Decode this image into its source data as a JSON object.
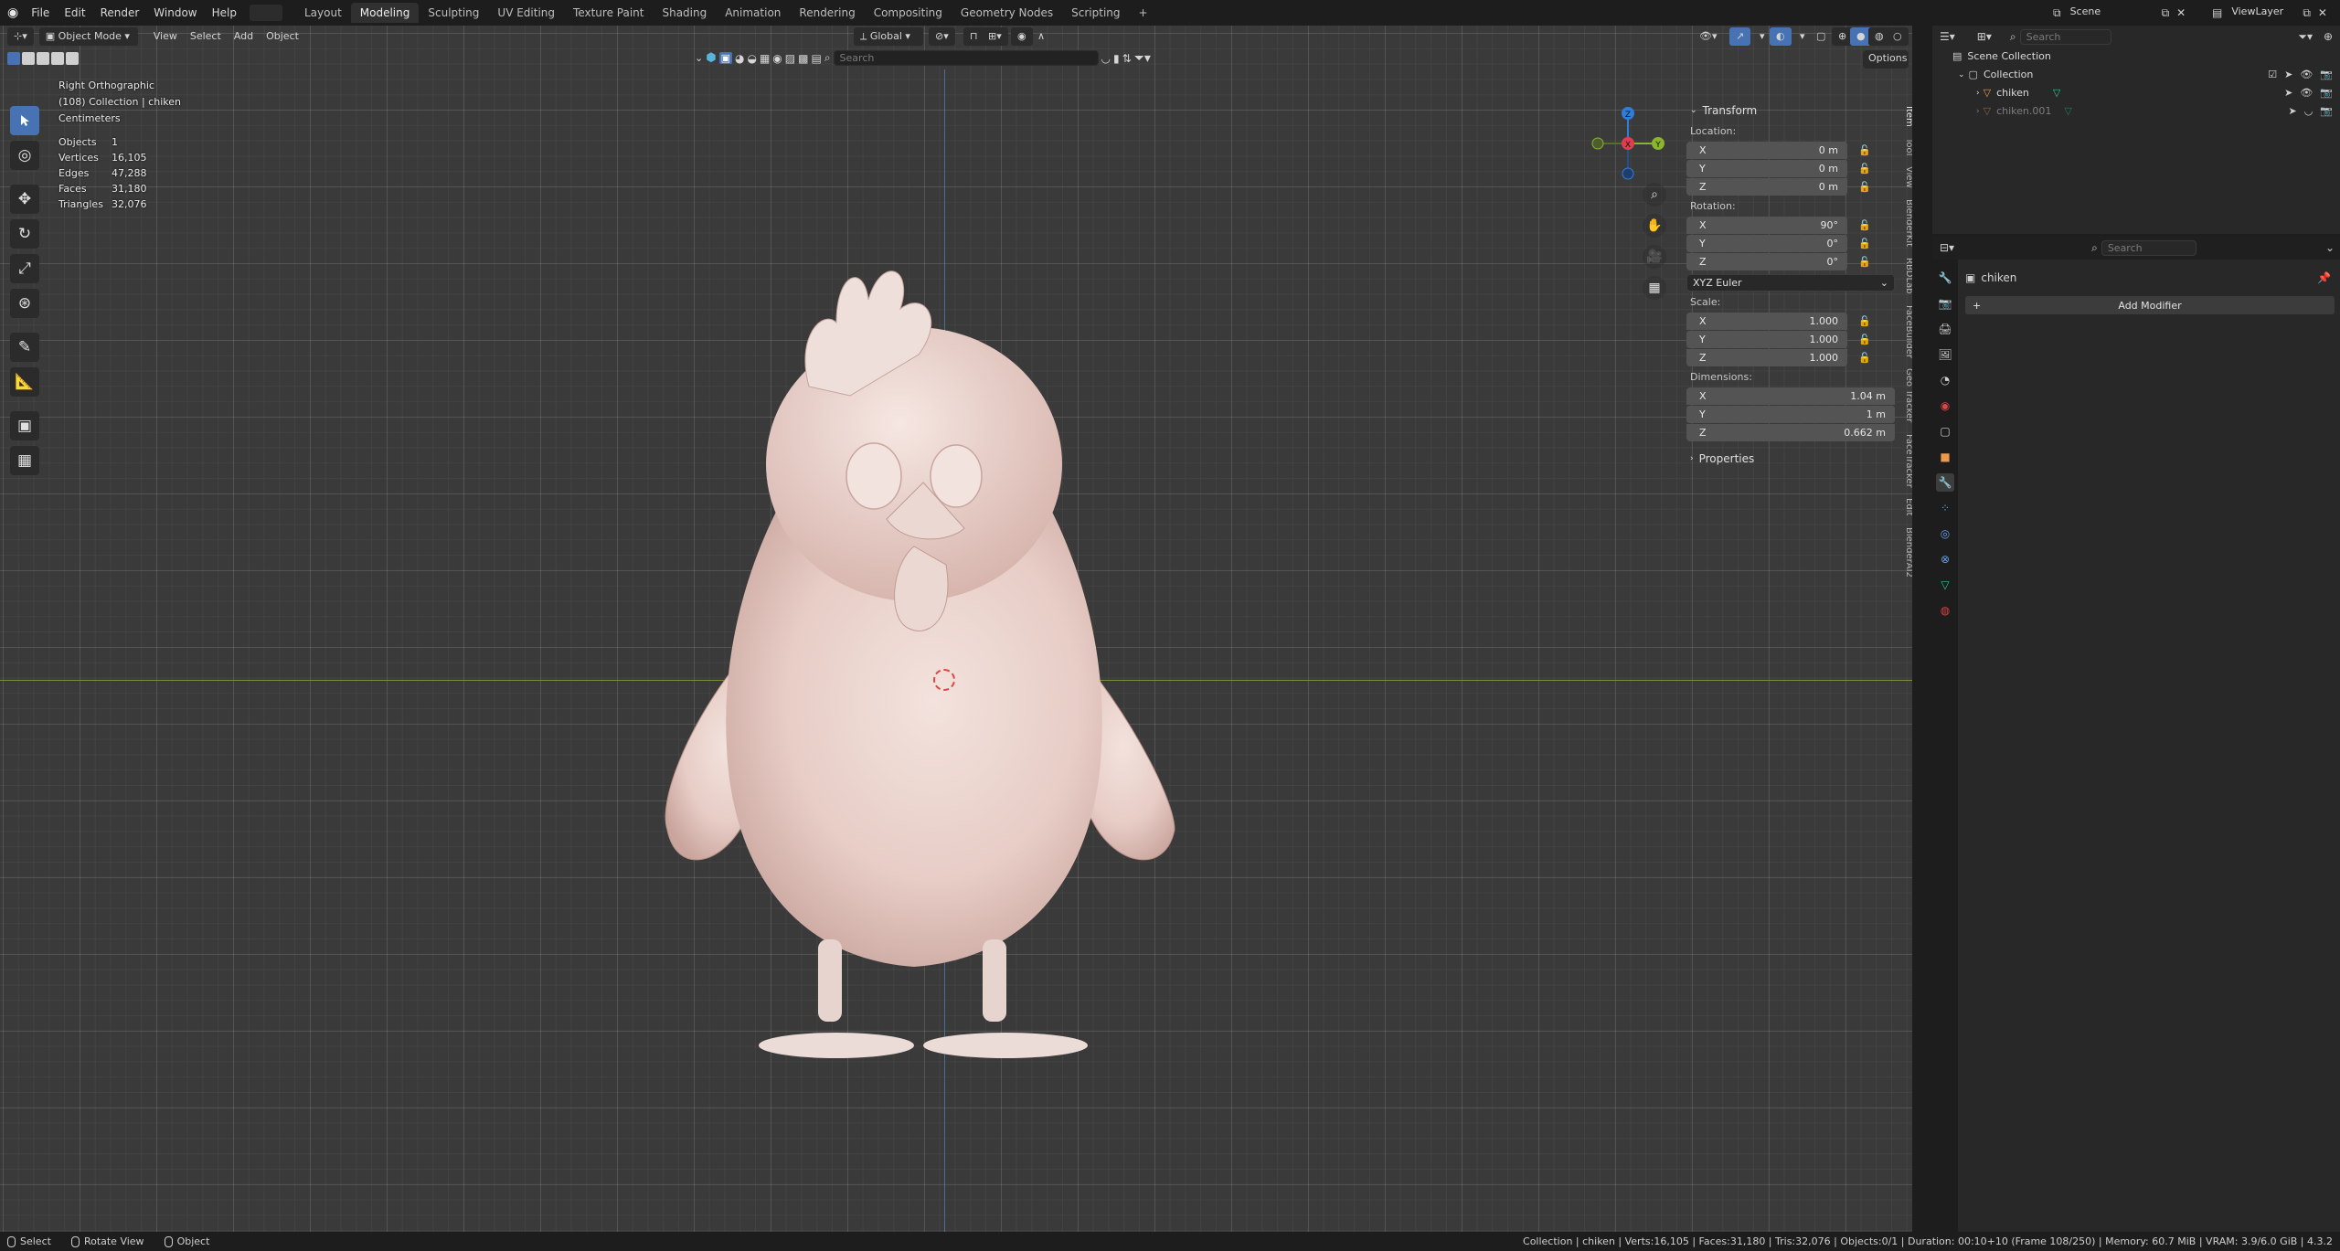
{
  "menu": [
    "File",
    "Edit",
    "Render",
    "Window",
    "Help"
  ],
  "workspaces": [
    "Layout",
    "Modeling",
    "Sculpting",
    "UV Editing",
    "Texture Paint",
    "Shading",
    "Animation",
    "Rendering",
    "Compositing",
    "Geometry Nodes",
    "Scripting",
    "+"
  ],
  "active_workspace": "Modeling",
  "scene": {
    "name": "Scene",
    "view_layer": "ViewLayer"
  },
  "viewport_header": {
    "mode": "Object Mode",
    "menus": [
      "View",
      "Select",
      "Add",
      "Object"
    ],
    "orientation": "Global",
    "options": "Options",
    "search_placeholder": "Search"
  },
  "overlay": {
    "view_name": "Right Orthographic",
    "collection_line": "(108) Collection | chiken",
    "units": "Centimeters",
    "stats": [
      {
        "label": "Objects",
        "value": "1"
      },
      {
        "label": "Vertices",
        "value": "16,105"
      },
      {
        "label": "Edges",
        "value": "47,288"
      },
      {
        "label": "Faces",
        "value": "31,180"
      },
      {
        "label": "Triangles",
        "value": "32,076"
      }
    ]
  },
  "gizmo": {
    "z": "Z",
    "y": "Y",
    "x": "X"
  },
  "transform": {
    "title": "Transform",
    "location_label": "Location:",
    "location": [
      {
        "axis": "X",
        "value": "0 m"
      },
      {
        "axis": "Y",
        "value": "0 m"
      },
      {
        "axis": "Z",
        "value": "0 m"
      }
    ],
    "rotation_label": "Rotation:",
    "rotation": [
      {
        "axis": "X",
        "value": "90°"
      },
      {
        "axis": "Y",
        "value": "0°"
      },
      {
        "axis": "Z",
        "value": "0°"
      }
    ],
    "rotation_mode": "XYZ Euler",
    "scale_label": "Scale:",
    "scale": [
      {
        "axis": "X",
        "value": "1.000"
      },
      {
        "axis": "Y",
        "value": "1.000"
      },
      {
        "axis": "Z",
        "value": "1.000"
      }
    ],
    "dimensions_label": "Dimensions:",
    "dimensions": [
      {
        "axis": "X",
        "value": "1.04 m"
      },
      {
        "axis": "Y",
        "value": "1 m"
      },
      {
        "axis": "Z",
        "value": "0.662 m"
      }
    ],
    "properties_label": "Properties"
  },
  "side_tabs": [
    "Item",
    "Tool",
    "View",
    "BlenderKit",
    "RBDLab",
    "FaceBuilder",
    "Geo Tracker",
    "FaceTracker",
    "Edit",
    "BlenderAI2"
  ],
  "outliner": {
    "search_placeholder": "Search",
    "root": "Scene Collection",
    "collection": "Collection",
    "objects": [
      "chiken",
      "chiken.001"
    ]
  },
  "properties": {
    "search_placeholder": "Search",
    "object_name": "chiken",
    "add_modifier": "Add Modifier"
  },
  "status": {
    "select": "Select",
    "rotate": "Rotate View",
    "object": "Object",
    "info": "Collection | chiken | Verts:16,105 | Faces:31,180 | Tris:32,076 | Objects:0/1 | Duration: 00:10+10 (Frame 108/250) | Memory: 60.7 MiB | VRAM: 3.9/6.0 GiB | 4.3.2"
  },
  "colors": {
    "accent": "#4772b3",
    "x_axis": "#e03d4f",
    "y_axis": "#8ab52c",
    "z_axis": "#2e7fdc",
    "mesh": "#eddbd6"
  }
}
